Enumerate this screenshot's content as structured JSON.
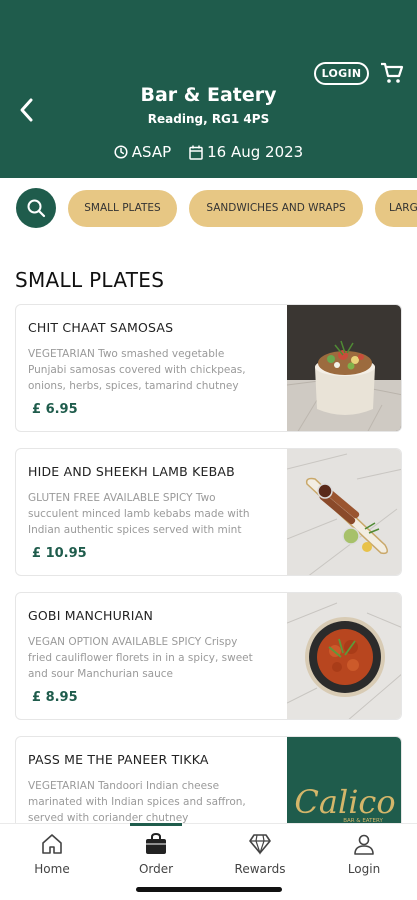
{
  "header": {
    "login_label": "LOGIN",
    "venue_name": "Bar & Eatery",
    "address": "Reading, RG1 4PS",
    "time_label": "ASAP",
    "date_label": "16 Aug 2023",
    "background_color": "#1f5c4c"
  },
  "categories": [
    "SMALL PLATES",
    "SANDWICHES AND WRAPS",
    "LARG"
  ],
  "section_title": "SMALL PLATES",
  "items": [
    {
      "name": "CHIT CHAAT SAMOSAS",
      "description": "VEGETARIAN Two smashed vegetable Punjabi samosas covered with chickpeas, onions, herbs, spices, tamarind chutney and sweet yoghurt...",
      "price": "£ 6.95"
    },
    {
      "name": "HIDE AND SHEEKH LAMB KEBAB",
      "description": "GLUTEN FREE AVAILABLE SPICY Two succulent minced lamb kebabs made with Indian authentic spices served with mint yoghurt and tamarind...",
      "price": "£ 10.95"
    },
    {
      "name": "GOBI MANCHURIAN",
      "description": "VEGAN OPTION AVAILABLE SPICY Crispy fried cauliflower florets in in a spicy, sweet and sour Manchurian sauce",
      "price": "£ 8.95"
    },
    {
      "name": "PASS ME THE PANEER TIKKA",
      "description": "VEGETARIAN Tandoori Indian cheese marinated with Indian spices and saffron, served with coriander chutney",
      "price": ""
    }
  ],
  "logo": {
    "brand": "Calico",
    "tagline": "BAR & EATERY"
  },
  "tabbar": [
    {
      "label": "Home",
      "icon": "home-icon"
    },
    {
      "label": "Order",
      "icon": "bag-icon"
    },
    {
      "label": "Rewards",
      "icon": "diamond-icon"
    },
    {
      "label": "Login",
      "icon": "user-icon"
    }
  ],
  "colors": {
    "primary": "#1f5c4c",
    "chip": "#e7c784",
    "price": "#1f5c4c",
    "logo_gold": "#d4b66a"
  }
}
